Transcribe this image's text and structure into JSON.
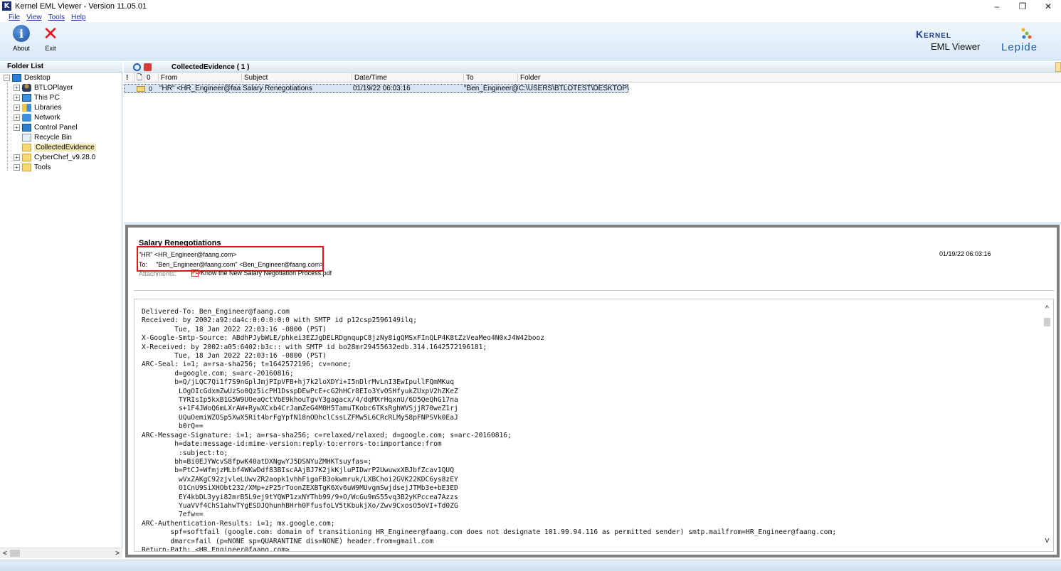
{
  "window": {
    "title": "Kernel EML Viewer - Version 11.05.01",
    "icon_letter": "K",
    "controls": {
      "minimize": "–",
      "restore": "❐",
      "close": "✕"
    }
  },
  "menu": [
    "File",
    "View",
    "Tools",
    "Help"
  ],
  "toolbar": {
    "about_label": "About",
    "exit_label": "Exit",
    "brand_kernel": "Kernel",
    "brand_product": "EML Viewer",
    "brand_lepide": "Lepide"
  },
  "folder_list": {
    "header": "Folder List",
    "items": [
      {
        "label": "Desktop",
        "icon": "desktop-icon",
        "expander": "–"
      },
      {
        "label": "BTLOPlayer",
        "icon": "user-folder-icon",
        "expander": "+"
      },
      {
        "label": "This PC",
        "icon": "computer-icon",
        "expander": "+"
      },
      {
        "label": "Libraries",
        "icon": "libraries-icon",
        "expander": "+"
      },
      {
        "label": "Network",
        "icon": "network-icon",
        "expander": "+"
      },
      {
        "label": "Control Panel",
        "icon": "control-panel-icon",
        "expander": "+"
      },
      {
        "label": "Recycle Bin",
        "icon": "recycle-bin-icon",
        "expander": ""
      },
      {
        "label": "CollectedEvidence",
        "icon": "folder-icon",
        "expander": ""
      },
      {
        "label": "CyberChef_v9.28.0",
        "icon": "folder-icon",
        "expander": "+"
      },
      {
        "label": "Tools",
        "icon": "folder-icon",
        "expander": "+"
      }
    ],
    "scroll_left": "<",
    "scroll_right": ">"
  },
  "email_list": {
    "title": "CollectedEvidence ( 1 )",
    "columns": {
      "importance": "!",
      "type": "🗋",
      "attachment": "0",
      "from": "From",
      "subject": "Subject",
      "datetime": "Date/Time",
      "to": "To",
      "folder": "Folder"
    },
    "rows": [
      {
        "from": "\"HR\" <HR_Engineer@faan...",
        "subject": "Salary Renegotiations",
        "datetime": "01/19/22 06:03:16",
        "to": "\"Ben_Engineer@...",
        "folder": "C:\\USERS\\BTLOTEST\\DESKTOP\\C..."
      }
    ]
  },
  "preview": {
    "subject": "Salary Renegotiations",
    "from": "\"HR\" <HR_Engineer@faang.com>",
    "date": "01/19/22 06:03:16",
    "to_label": "To:",
    "to": "\"Ben_Engineer@faang.com\" <Ben_Engineer@faang.com>",
    "attachments_label": "Attachments:",
    "attachment_icon": "PDF",
    "attachment": "Know the New Salary Negotiation Process.pdf",
    "headers": "Delivered-To: Ben_Engineer@faang.com\nReceived: by 2002:a92:da4c:0:0:0:0:0 with SMTP id p12csp2596149ilq;\n        Tue, 18 Jan 2022 22:03:16 -0800 (PST)\nX-Google-Smtp-Source: ABdhPJybWLE/phkei3EZJgDELRDgnqupC8jzNy8igQMSxFInQLP4K8tZzVeaMeo4N0xJ4W42booz\nX-Received: by 2002:a05:6402:b3c:: with SMTP id bo28mr29455632edb.314.1642572196181;\n        Tue, 18 Jan 2022 22:03:16 -0800 (PST)\nARC-Seal: i=1; a=rsa-sha256; t=1642572196; cv=none;\n        d=google.com; s=arc-20160816;\n        b=Q/jLQC7Qi1f7S9nGplJmjPIpVFB+hj7k2loXDYi+I5nDlrMvLnI3EwIpullFQmMKuq\n         LOgOIcGdxmZwUzSo0Qz5icPH1DsspDEwPcE+cG2hHCr8EIo3YvOSHfyukZUxpV2hZKeZ\n         TYRIsIp5kxB1G5W9UOeaQctVbE9khouTgvY3gagacx/4/dqMXrHqxnU/6D5QeQhG17na\n         s+1F4JWoQ6mLXrAW+RywXCxb4CrJamZeG4M0H5TamuTKobc6TKsRghWVSjjR70weZ1rj\n         UQuOemiWZOSp5XwX5Rit4brFgYpfN18nODhclCssLZFMw5L6CRcRLMy58pFNPSVk0EaJ\n         b0rQ==\nARC-Message-Signature: i=1; a=rsa-sha256; c=relaxed/relaxed; d=google.com; s=arc-20160816;\n        h=date:message-id:mime-version:reply-to:errors-to:importance:from\n         :subject:to;\n        bh=Bi0EJYWcvS8fpwK40atDXNgwYJ5DSNYuZMHKTsuyfas=;\n        b=PtCJ+WfmjzMLbf4WKwDdf83BIscAAjBJ7K2jkKjluPIDwrP2UwuwxXBJbfZcav1QUQ\n         wVxZAKgC92zjvleLUwvZR2aopk1vhhFigaFB3okwmruk/LXBChoi2GVK22KDC6ys8zEY\n         O1CnU9SiXHObt232/XMp+zP25rToonZEXBTgK6Xv6uW9MUvgmSwjdsejJTMb3e+bE3ED\n         EY4kbDL3yyi82mrB5L9ej9tYQWP1zxNYThb99/9+O/WcGu9mS55vq3B2yKPccea7Azzs\n         YuaVVf4ChS1ahwTYgESDJQhunhBHrh0FfusfoLV5tKbukjXo/Zwv9CxosO5oVI+Td0ZG\n         7efw==\nARC-Authentication-Results: i=1; mx.google.com;\n       spf=softfail (google.com: domain of transitioning HR_Engineer@faang.com does not designate 101.99.94.116 as permitted sender) smtp.mailfrom=HR_Engineer@faang.com;\n       dmarc=fail (p=NONE sp=QUARANTINE dis=NONE) header.from=gmail.com\nReturn-Path: <HR_Engineer@faang.com>",
    "scroll_up": "^",
    "scroll_down": "v"
  }
}
